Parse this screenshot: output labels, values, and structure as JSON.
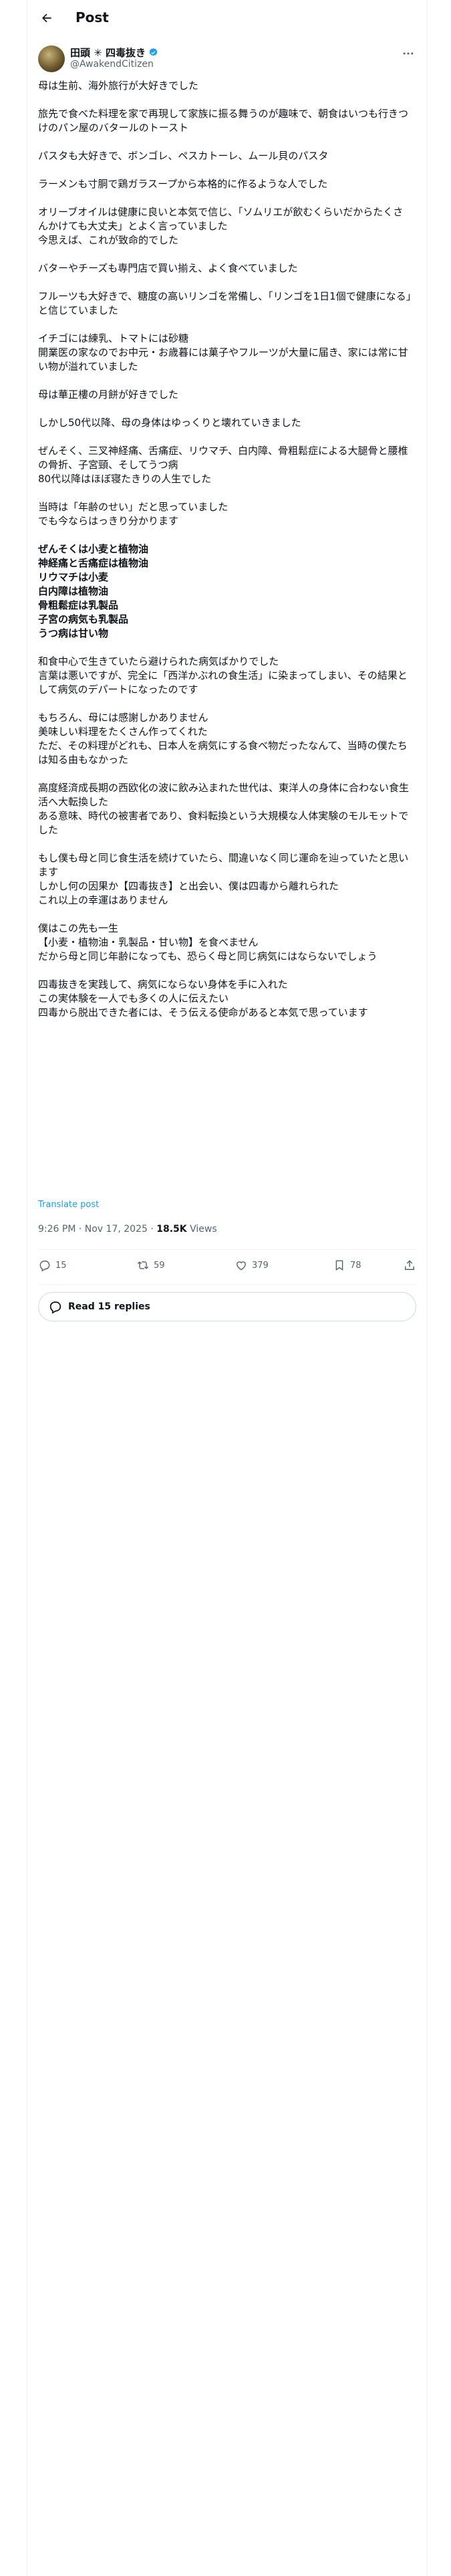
{
  "header": {
    "title": "Post"
  },
  "author": {
    "display_name": "田頭 ✳︎ 四毒抜き",
    "handle": "@AwakendCitizen",
    "verified_color": "#1d9bf0"
  },
  "post": {
    "paragraphs": [
      "母は生前、海外旅行が大好きでした",
      "旅先で食べた料理を家で再現して家族に振る舞うのが趣味で、朝食はいつも行きつけのパン屋のバタールのトースト",
      "パスタも大好きで、ボンゴレ、ペスカトーレ、ムール貝のパスタ",
      "ラーメンも寸胴で鶏ガラスープから本格的に作るような人でした",
      "オリーブオイルは健康に良いと本気で信じ、「ソムリエが飲むくらいだからたくさんかけても大丈夫」とよく言っていました\n今思えば、これが致命的でした",
      "バターやチーズも専門店で買い揃え、よく食べていました",
      "フルーツも大好きで、糖度の高いリンゴを常備し、「リンゴを1日1個で健康になる」と信じていました",
      "イチゴには練乳、トマトには砂糖\n開業医の家なのでお中元・お歳暮には菓子やフルーツが大量に届き、家には常に甘い物が溢れていました",
      "母は華正樓の月餅が好きでした",
      "しかし50代以降、母の身体はゆっくりと壊れていきました",
      "ぜんそく、三叉神経痛、舌痛症、リウマチ、白内障、骨粗鬆症による大腿骨と腰椎の骨折、子宮頸、そしてうつ病\n80代以降はほぼ寝たきりの人生でした",
      "当時は「年齢のせい」だと思っていました\nでも今ならはっきり分かります",
      "和食中心で生きていたら避けられた病気ばかりでした\n言葉は悪いですが、完全に「西洋かぶれの食生活」に染まってしまい、その結果として病気のデパートになったのです",
      "もちろん、母には感謝しかありません\n美味しい料理をたくさん作ってくれた\nただ、その料理がどれも、日本人を病気にする食べ物だったなんて、当時の僕たちは知る由もなかった",
      "高度経済成長期の西欧化の波に飲み込まれた世代は、東洋人の身体に合わない食生活へ大転換した\nある意味、時代の被害者であり、食料転換という大規模な人体実験のモルモットでした",
      "もし僕も母と同じ食生活を続けていたら、間違いなく同じ運命を辿っていたと思います\nしかし何の因果か【四毒抜き】と出会い、僕は四毒から離れられた\nこれ以上の幸運はありません",
      "僕はこの先も一生\n【小麦・植物油・乳製品・甘い物】を食べません\nだから母と同じ年齢になっても、恐らく母と同じ病気にはならないでしょう",
      "四毒抜きを実践して、病気にならない身体を手に入れた\nこの実体験を一人でも多くの人に伝えたい\n四毒から脱出できた者には、そう伝える使命があると本気で思っています"
    ],
    "bold_list": [
      "ぜんそくは小麦と植物油",
      "神経痛と舌痛症は植物油",
      "リウマチは小麦",
      "白内障は植物油",
      "骨粗鬆症は乳製品",
      "子宮の病気も乳製品",
      "うつ病は甘い物"
    ],
    "translate_label": "Translate post",
    "timestamp": "9:26 PM · Nov 17, 2025",
    "dot": " · ",
    "views_count": "18.5K",
    "views_label": " Views"
  },
  "actions": {
    "replies": "15",
    "reposts": "59",
    "likes": "379",
    "bookmarks": "78"
  },
  "read_replies": {
    "label": "Read 15 replies"
  }
}
